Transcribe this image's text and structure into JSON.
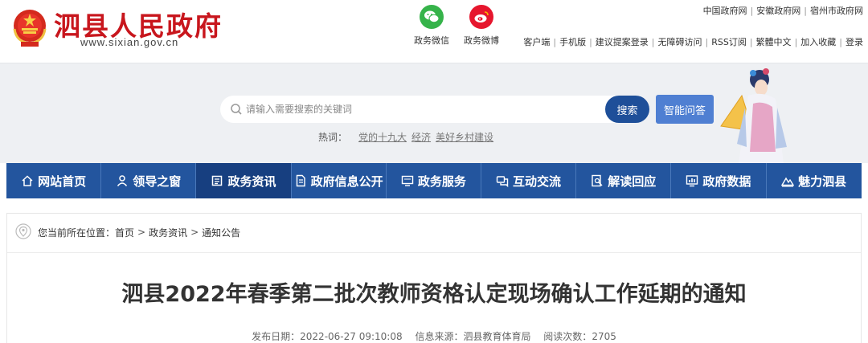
{
  "header": {
    "site_title": "泗县人民政府",
    "site_domain": "www.sixian.gov.cn",
    "social": [
      {
        "label": "政务微信",
        "icon": "wechat-icon",
        "color": "#36b34a"
      },
      {
        "label": "政务微博",
        "icon": "weibo-icon",
        "color": "#e6162d"
      }
    ],
    "links_top": [
      "中国政府网",
      "安徽政府网",
      "宿州市政府网"
    ],
    "links_bottom": [
      "客户端",
      "手机版",
      "建议提案登录",
      "无障碍访问",
      "RSS订阅",
      "繁體中文",
      "加入收藏",
      "登录"
    ]
  },
  "search": {
    "placeholder": "请输入需要搜索的关键词",
    "button": "搜索",
    "ai_button": "智能问答",
    "hot_label": "热词：",
    "hot_words": [
      "党的十九大",
      "经济",
      "美好乡村建设"
    ]
  },
  "nav": {
    "items": [
      {
        "label": "网站首页",
        "icon": "home-icon"
      },
      {
        "label": "领导之窗",
        "icon": "person-icon"
      },
      {
        "label": "政务资讯",
        "icon": "news-icon",
        "active": true
      },
      {
        "label": "政府信息公开",
        "icon": "document-icon"
      },
      {
        "label": "政务服务",
        "icon": "monitor-icon"
      },
      {
        "label": "互动交流",
        "icon": "chat-icon"
      },
      {
        "label": "解读回应",
        "icon": "search-doc-icon"
      },
      {
        "label": "政府数据",
        "icon": "chart-icon"
      },
      {
        "label": "魅力泗县",
        "icon": "mountain-icon"
      }
    ],
    "color": "#23559e"
  },
  "breadcrumb": {
    "prefix": "您当前所在位置：",
    "items": [
      "首页",
      "政务资讯",
      "通知公告"
    ],
    "separator": ">"
  },
  "article": {
    "title": "泗县2022年春季第二批次教师资格认定现场确认工作延期的通知",
    "publish_label": "发布日期：",
    "publish_date": "2022-06-27 09:10:08",
    "source_label": "信息来源：",
    "source": "泗县教育体育局",
    "views_label": "阅读次数：",
    "views": "2705"
  },
  "colors": {
    "brand_red": "#c8161d",
    "nav_blue": "#23559e",
    "search_button": "#1e4f99",
    "ai_button": "#4f7fd2"
  }
}
